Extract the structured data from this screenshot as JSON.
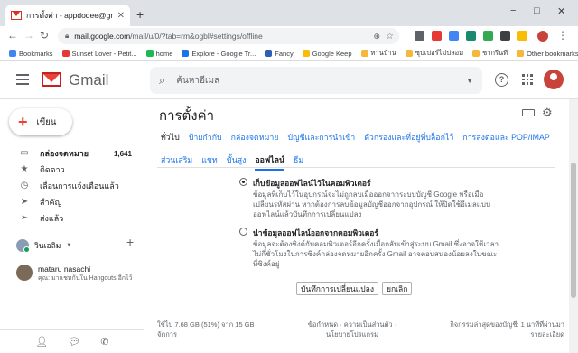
{
  "browser": {
    "tab_title": "การตั้งค่า - appdodee@gmail.com",
    "url_host": "mail.google.com",
    "url_path": "/mail/u/0/?tab=rm&ogbl#settings/offline",
    "window_controls": [
      "−",
      "□",
      "✕"
    ]
  },
  "bookmarks": [
    {
      "label": "Bookmarks",
      "color": "#4285f4"
    },
    {
      "label": "Sunset Lover - Petit...",
      "color": "#e53935"
    },
    {
      "label": "home",
      "color": "#1db954"
    },
    {
      "label": "Explore - Google Tr...",
      "color": "#1a73e8"
    },
    {
      "label": "Fancy",
      "color": "#2f5fb3"
    },
    {
      "label": "Google Keep",
      "color": "#fbbc04"
    },
    {
      "label": "ทานบ้าน",
      "color": "#f6b73c"
    },
    {
      "label": "ซุปเปอร์ไม่ปลอม",
      "color": "#f6b73c"
    },
    {
      "label": "ชากรีนที",
      "color": "#f6b73c"
    },
    {
      "label": "Other bookmarks",
      "color": "#f6b73c"
    }
  ],
  "gmail": {
    "logo_text": "Gmail",
    "search_placeholder": "ค้นหาอีเมล"
  },
  "sidebar": {
    "compose_label": "เขียน",
    "items": [
      {
        "label": "กล่องจดหมาย",
        "count": "1,641",
        "icon": "inbox-icon",
        "bold": true
      },
      {
        "label": "ติดดาว",
        "count": "",
        "icon": "star-icon"
      },
      {
        "label": "เลื่อนการแจ้งเตือนแล้ว",
        "count": "",
        "icon": "clock-icon"
      },
      {
        "label": "สำคัญ",
        "count": "",
        "icon": "important-icon"
      },
      {
        "label": "ส่งแล้ว",
        "count": "",
        "icon": "send-icon"
      }
    ],
    "hangouts_me": "วินเอลิม",
    "contact_name": "mataru nasachi",
    "contact_status": "คุณ: มาแชทกันใน Hangouts อีกไว้"
  },
  "settings": {
    "title": "การตั้งค่า",
    "tabs_row1": [
      "ทั่วไป",
      "ป้ายกำกับ",
      "กล่องจดหมาย",
      "บัญชีและการนำเข้า",
      "ตัวกรองและที่อยู่ที่บล็อกไว้",
      "การส่งต่อและ POP/IMAP"
    ],
    "tabs_row2": [
      "ส่วนเสริม",
      "แชท",
      "ขั้นสูง",
      "ออฟไลน์",
      "ธีม"
    ],
    "active_tab": "ออฟไลน์",
    "option1_title": "เก็บข้อมูลออฟไลน์ไว้ในคอมพิวเตอร์",
    "option1_desc": "ข้อมูลที่เก็บไว้ในอุปกรณ์จะไม่ถูกลบเมื่อออกจากระบบบัญชี Google หรือเมื่อเปลี่ยนรหัสผ่าน หากต้องการลบข้อมูลบัญชีออกจากอุปกรณ์ ให้ปิดใช้อีเมลแบบออฟไลน์แล้วบันทึกการเปลี่ยนแปลง",
    "option2_title": "นำข้อมูลออฟไลน์ออกจากคอมพิวเตอร์",
    "option2_desc": "ข้อมูลจะต้องซิงค์กับคอมพิวเตอร์อีกครั้งเมื่อกลับเข้าสู่ระบบ Gmail ซึ่งอาจใช้เวลาไม่กี่ชั่วโมงในการซิงค์กล่องจดหมายอีกครั้ง Gmail อาจตอบสนองน้อยลงในขณะที่ซิงค์อยู่",
    "save_button": "บันทึกการเปลี่ยนแปลง",
    "cancel_button": "ยกเลิก",
    "storage": "ใช้ไป 7.68 GB (51%) จาก 15 GB",
    "manage": "จัดการ",
    "terms": "ข้อกำหนด · ความเป็นส่วนตัว · นโยบายโปรแกรม",
    "activity": "กิจกรรมล่าสุดของบัญชี: 1 นาทีที่ผ่านมา",
    "details": "รายละเอียด"
  }
}
